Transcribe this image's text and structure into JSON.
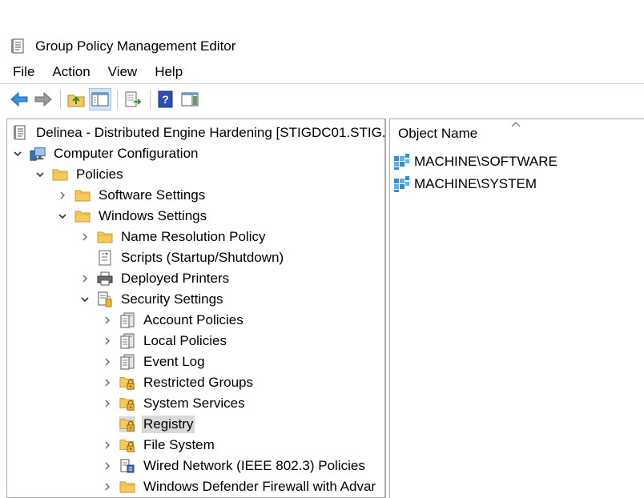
{
  "window": {
    "title": "Group Policy Management Editor",
    "icon": "gpo-editor-icon"
  },
  "menu": [
    {
      "label": "File"
    },
    {
      "label": "Action"
    },
    {
      "label": "View"
    },
    {
      "label": "Help"
    }
  ],
  "toolbar": {
    "buttons": [
      {
        "icon": "back-arrow-icon",
        "active": false
      },
      {
        "icon": "forward-arrow-icon",
        "active": false
      },
      {
        "icon": "up-folder-icon",
        "active": false
      },
      {
        "icon": "show-hide-console-tree-icon",
        "active": true
      },
      {
        "icon": "export-list-icon",
        "active": false
      },
      {
        "icon": "help-icon",
        "active": false
      },
      {
        "icon": "show-hide-action-pane-icon",
        "active": false
      }
    ]
  },
  "tree": {
    "items": [
      {
        "label": "Delinea - Distributed Engine Hardening [STIGDC01.STIG.I",
        "icon": "gpo-document-icon",
        "chevron": "none",
        "level": 0
      },
      {
        "label": "Computer Configuration",
        "icon": "computer-icon",
        "chevron": "down",
        "level": 0
      },
      {
        "label": "Policies",
        "icon": "folder-icon",
        "chevron": "down",
        "level": 1
      },
      {
        "label": "Software Settings",
        "icon": "folder-icon",
        "chevron": "right",
        "level": 2
      },
      {
        "label": "Windows Settings",
        "icon": "folder-icon",
        "chevron": "down",
        "level": 2
      },
      {
        "label": "Name Resolution Policy",
        "icon": "folder-icon",
        "chevron": "right",
        "level": 3
      },
      {
        "label": "Scripts (Startup/Shutdown)",
        "icon": "script-icon",
        "chevron": "none",
        "level": 3
      },
      {
        "label": "Deployed Printers",
        "icon": "printer-icon",
        "chevron": "right",
        "level": 3
      },
      {
        "label": "Security Settings",
        "icon": "security-settings-icon",
        "chevron": "down",
        "level": 3
      },
      {
        "label": "Account Policies",
        "icon": "policy-book-icon",
        "chevron": "right",
        "level": 4
      },
      {
        "label": "Local Policies",
        "icon": "policy-book-icon",
        "chevron": "right",
        "level": 4
      },
      {
        "label": "Event Log",
        "icon": "policy-book-icon",
        "chevron": "right",
        "level": 4
      },
      {
        "label": "Restricted Groups",
        "icon": "locked-folder-icon",
        "chevron": "right",
        "level": 4
      },
      {
        "label": "System Services",
        "icon": "locked-folder-icon",
        "chevron": "right",
        "level": 4
      },
      {
        "label": "Registry",
        "icon": "locked-folder-icon",
        "chevron": "none",
        "level": 4,
        "selected": true
      },
      {
        "label": "File System",
        "icon": "locked-folder-icon",
        "chevron": "right",
        "level": 4
      },
      {
        "label": "Wired Network (IEEE 802.3) Policies",
        "icon": "network-policy-icon",
        "chevron": "right",
        "level": 4
      },
      {
        "label": "Windows Defender Firewall with Advar",
        "icon": "folder-icon",
        "chevron": "right",
        "level": 4
      }
    ]
  },
  "list": {
    "column_header": "Object Name",
    "rows": [
      {
        "label": "MACHINE\\SOFTWARE",
        "icon": "registry-key-icon"
      },
      {
        "label": "MACHINE\\SYSTEM",
        "icon": "registry-key-icon"
      }
    ]
  },
  "colors": {
    "selection": "#d9d9d9",
    "pane_border": "#a9a9a9",
    "folder": "#f5c95c",
    "registry": "#2f8fd6"
  }
}
